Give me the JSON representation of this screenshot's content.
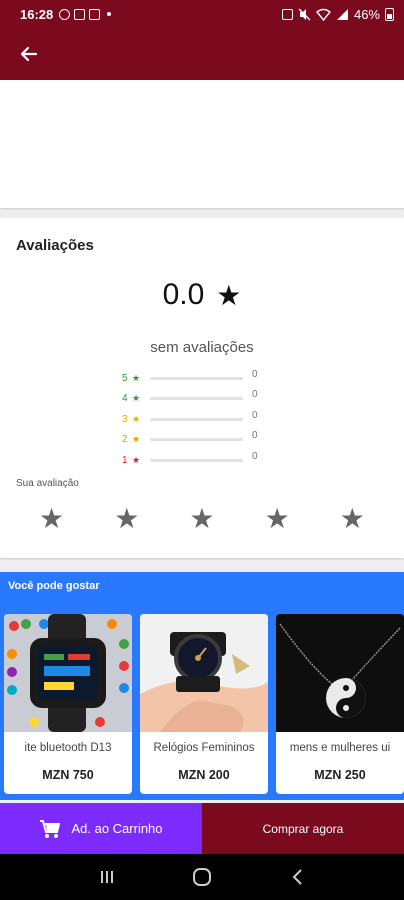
{
  "status_bar": {
    "time": "16:28",
    "battery": "46%"
  },
  "reviews": {
    "title": "Avaliações",
    "score": "0.0",
    "no_reviews": "sem avaliações",
    "rows": [
      {
        "stars": "5",
        "count": "0",
        "color": "#2e9c2e"
      },
      {
        "stars": "4",
        "count": "0",
        "color": "#2e9c2e"
      },
      {
        "stars": "3",
        "count": "0",
        "color": "#d8b400"
      },
      {
        "stars": "2",
        "count": "0",
        "color": "#e39b00"
      },
      {
        "stars": "1",
        "count": "0",
        "color": "#d41f1f"
      }
    ],
    "your_rating_label": "Sua avaliação"
  },
  "suggestions": {
    "title": "Você pode gostar",
    "products": [
      {
        "name": "ite bluetooth D13",
        "price": "MZN 750"
      },
      {
        "name": "Relógios Femininos",
        "price": "MZN 200"
      },
      {
        "name": "mens e mulheres ui",
        "price": "MZN 250"
      }
    ]
  },
  "actions": {
    "add_to_cart": "Ad. ao Carrinho",
    "buy_now": "Comprar agora"
  },
  "colors": {
    "primary": "#7b0a1e",
    "cart": "#7c2bff",
    "suggest_bg": "#2979ff"
  }
}
